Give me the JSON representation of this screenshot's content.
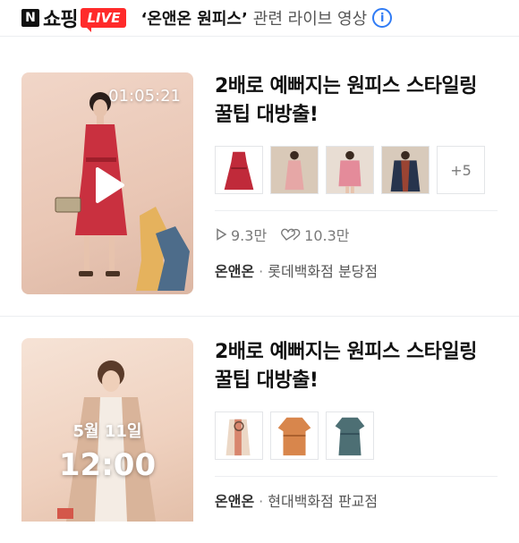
{
  "header": {
    "logo_n": "N",
    "logo_text": "쇼핑",
    "live_badge": "LIVE",
    "query": "‘온앤온 원피스’",
    "suffix": "관련 라이브 영상",
    "info_icon": "info-icon"
  },
  "cards": [
    {
      "timer": "01:05:21",
      "title": "2배로 예뻐지는 원피스 스타일링 꿀팁 대방출!",
      "more": "+5",
      "views": "9.3만",
      "likes": "10.3만",
      "seller": "온앤온",
      "branch": "롯데백화점 분당점"
    },
    {
      "date": "5월 11일",
      "time": "12:00",
      "title": "2배로 예뻐지는 원피스 스타일링 꿀팁 대방출!",
      "seller": "온앤온",
      "branch": "현대백화점 판교점"
    }
  ],
  "colors": {
    "live": "#ff2b2b",
    "info": "#2f7bf5"
  }
}
